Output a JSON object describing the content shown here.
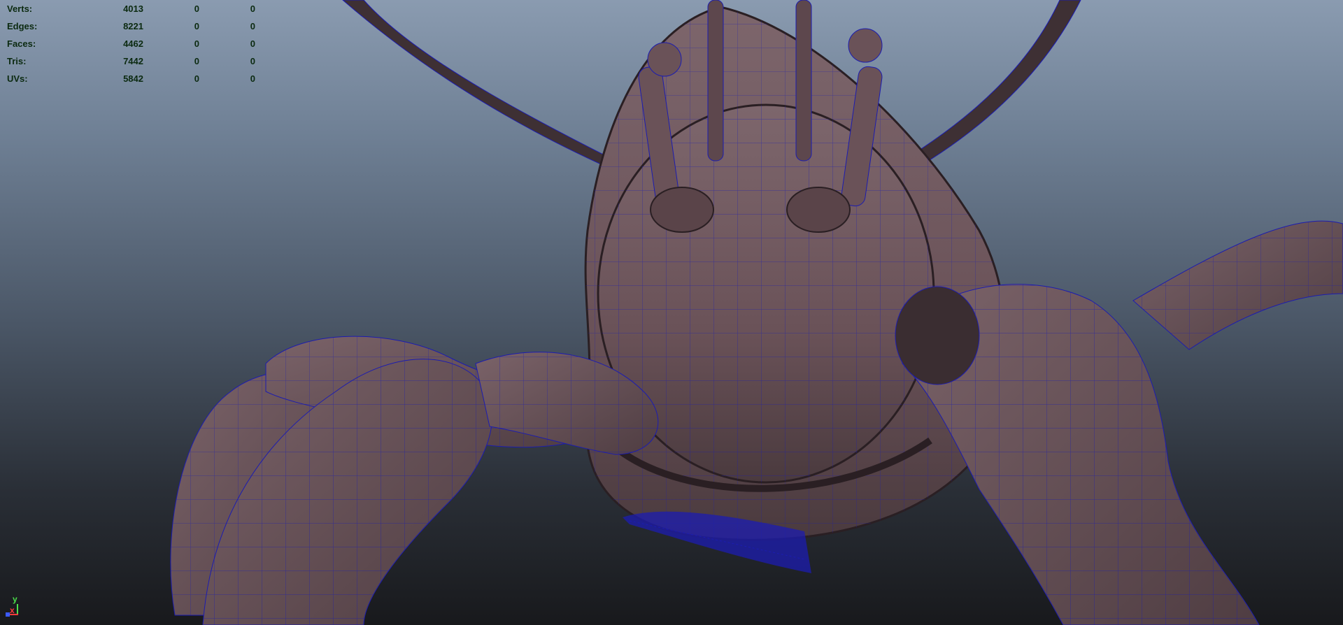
{
  "stats": {
    "rows": [
      {
        "label": "Verts:",
        "total": "4013",
        "selected": "0",
        "component": "0"
      },
      {
        "label": "Edges:",
        "total": "8221",
        "selected": "0",
        "component": "0"
      },
      {
        "label": "Faces:",
        "total": "4462",
        "selected": "0",
        "component": "0"
      },
      {
        "label": "Tris:",
        "total": "7442",
        "selected": "0",
        "component": "0"
      },
      {
        "label": "UVs:",
        "total": "5842",
        "selected": "0",
        "component": "0"
      }
    ]
  },
  "axis": {
    "y_label": "y",
    "x_label": "x"
  },
  "colors": {
    "hud_text": "#0b2a10",
    "mesh": "#6a5258",
    "wire": "#1c1cb0",
    "axis_x": "#ff3b3b",
    "axis_y": "#4be04b",
    "axis_z": "#3b5bff"
  }
}
